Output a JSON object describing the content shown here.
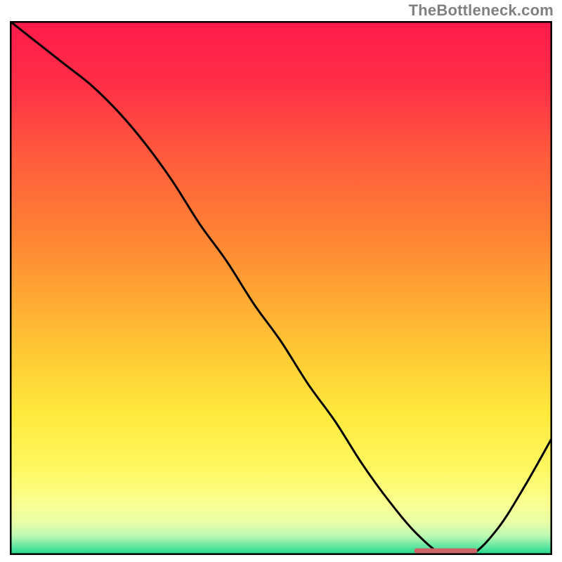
{
  "watermark": "TheBottleneck.com",
  "chart_data": {
    "type": "line",
    "title": "",
    "xlabel": "",
    "ylabel": "",
    "xlim": [
      0,
      100
    ],
    "ylim": [
      0,
      100
    ],
    "grid": false,
    "legend": false,
    "series": [
      {
        "name": "curve",
        "x": [
          0,
          5,
          10,
          15,
          20,
          25,
          30,
          35,
          40,
          45,
          50,
          55,
          60,
          65,
          70,
          75,
          80,
          85,
          90,
          95,
          100
        ],
        "y": [
          100,
          96,
          92,
          88,
          83,
          77,
          70,
          62,
          55,
          47,
          40,
          32,
          25,
          17,
          10,
          4,
          0,
          0,
          5,
          13,
          22
        ]
      }
    ],
    "flat_region": {
      "x_start": 75,
      "x_end": 86,
      "y": 0
    },
    "flat_marker_color": "#cc6666",
    "background_gradient": {
      "stops": [
        {
          "offset": 0.0,
          "color": "#ff1a4b"
        },
        {
          "offset": 0.12,
          "color": "#ff2f47"
        },
        {
          "offset": 0.25,
          "color": "#ff5a3d"
        },
        {
          "offset": 0.38,
          "color": "#ff7d35"
        },
        {
          "offset": 0.5,
          "color": "#ffa233"
        },
        {
          "offset": 0.62,
          "color": "#ffc934"
        },
        {
          "offset": 0.74,
          "color": "#ffea3e"
        },
        {
          "offset": 0.84,
          "color": "#fff862"
        },
        {
          "offset": 0.9,
          "color": "#fbff8e"
        },
        {
          "offset": 0.94,
          "color": "#e8ffa8"
        },
        {
          "offset": 0.965,
          "color": "#b8f8b0"
        },
        {
          "offset": 0.985,
          "color": "#5ee6a0"
        },
        {
          "offset": 1.0,
          "color": "#17d68a"
        }
      ]
    },
    "frame_color": "#000000",
    "line_color": "#000000"
  }
}
